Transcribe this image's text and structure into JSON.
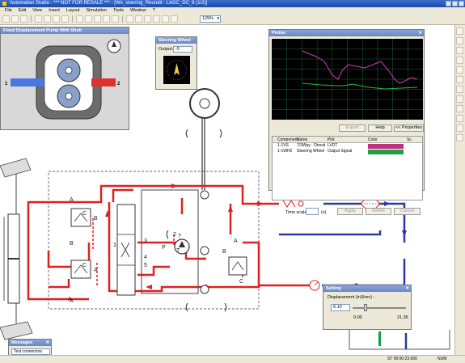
{
  "window": {
    "title": "Automation Studio - *** NOT FOR RESALE *** - [Wo_steering_Reundit : LAGC_DC_8 (1/2)]"
  },
  "menu": {
    "items": [
      "File",
      "Edit",
      "View",
      "Insert",
      "Layout",
      "Simulation",
      "Tools",
      "Window",
      "?"
    ]
  },
  "toolbar": {
    "zoom": "125%"
  },
  "pump_window": {
    "title": "Fixed Displacement Pump With Shaft",
    "port1": "1",
    "port2": "2"
  },
  "steering_window": {
    "title": "Steering Wheel",
    "output_label": "Output:",
    "output_value": "-5"
  },
  "plotter": {
    "title": "Plotter",
    "buttons": {
      "export": "Export",
      "help": "Help",
      "properties": "<< Properties",
      "apply": "Apply",
      "delete": "Delete",
      "cancel": "Cancel"
    },
    "table": {
      "headers": [
        "Component",
        "Name",
        "Plot",
        "Color",
        "Sc"
      ],
      "rows": [
        {
          "component": "1-1VS",
          "name": "7/3Way - Directi",
          "plot": "LVDT",
          "color": "#c03080"
        },
        {
          "component": "1-1WH2",
          "name": "Steering Wheel",
          "plot": "Output Signal",
          "color": "#20a040"
        }
      ]
    },
    "timescale_label": "Time scale",
    "timescale_unit": "(s)",
    "series_colors": {
      "lvdt": "#d040b0",
      "output": "#20c040"
    }
  },
  "setting_window": {
    "title": "Setting",
    "label": "Displacement (in3/rev) :",
    "value": "6.10",
    "min": "0.00",
    "max": "21.36"
  },
  "messages_window": {
    "title": "Messages",
    "selection": "Test connectors"
  },
  "status": {
    "time": "ST 00:00:23.600",
    "num": "NUM"
  },
  "schematic": {
    "letters": {
      "A": "A",
      "B": "B",
      "C": "C",
      "P": "P",
      "T": "T",
      "n1": "1",
      "n2": "2",
      "n3": "3",
      "n4": "4",
      "n5": "5",
      "q": "?"
    }
  },
  "colors": {
    "pressure_line": "#e02020",
    "tank_line": "#2a3aa0",
    "green_line": "#10a040",
    "plot_bg": "#000000",
    "plot_grid": "#1a6b3a"
  }
}
